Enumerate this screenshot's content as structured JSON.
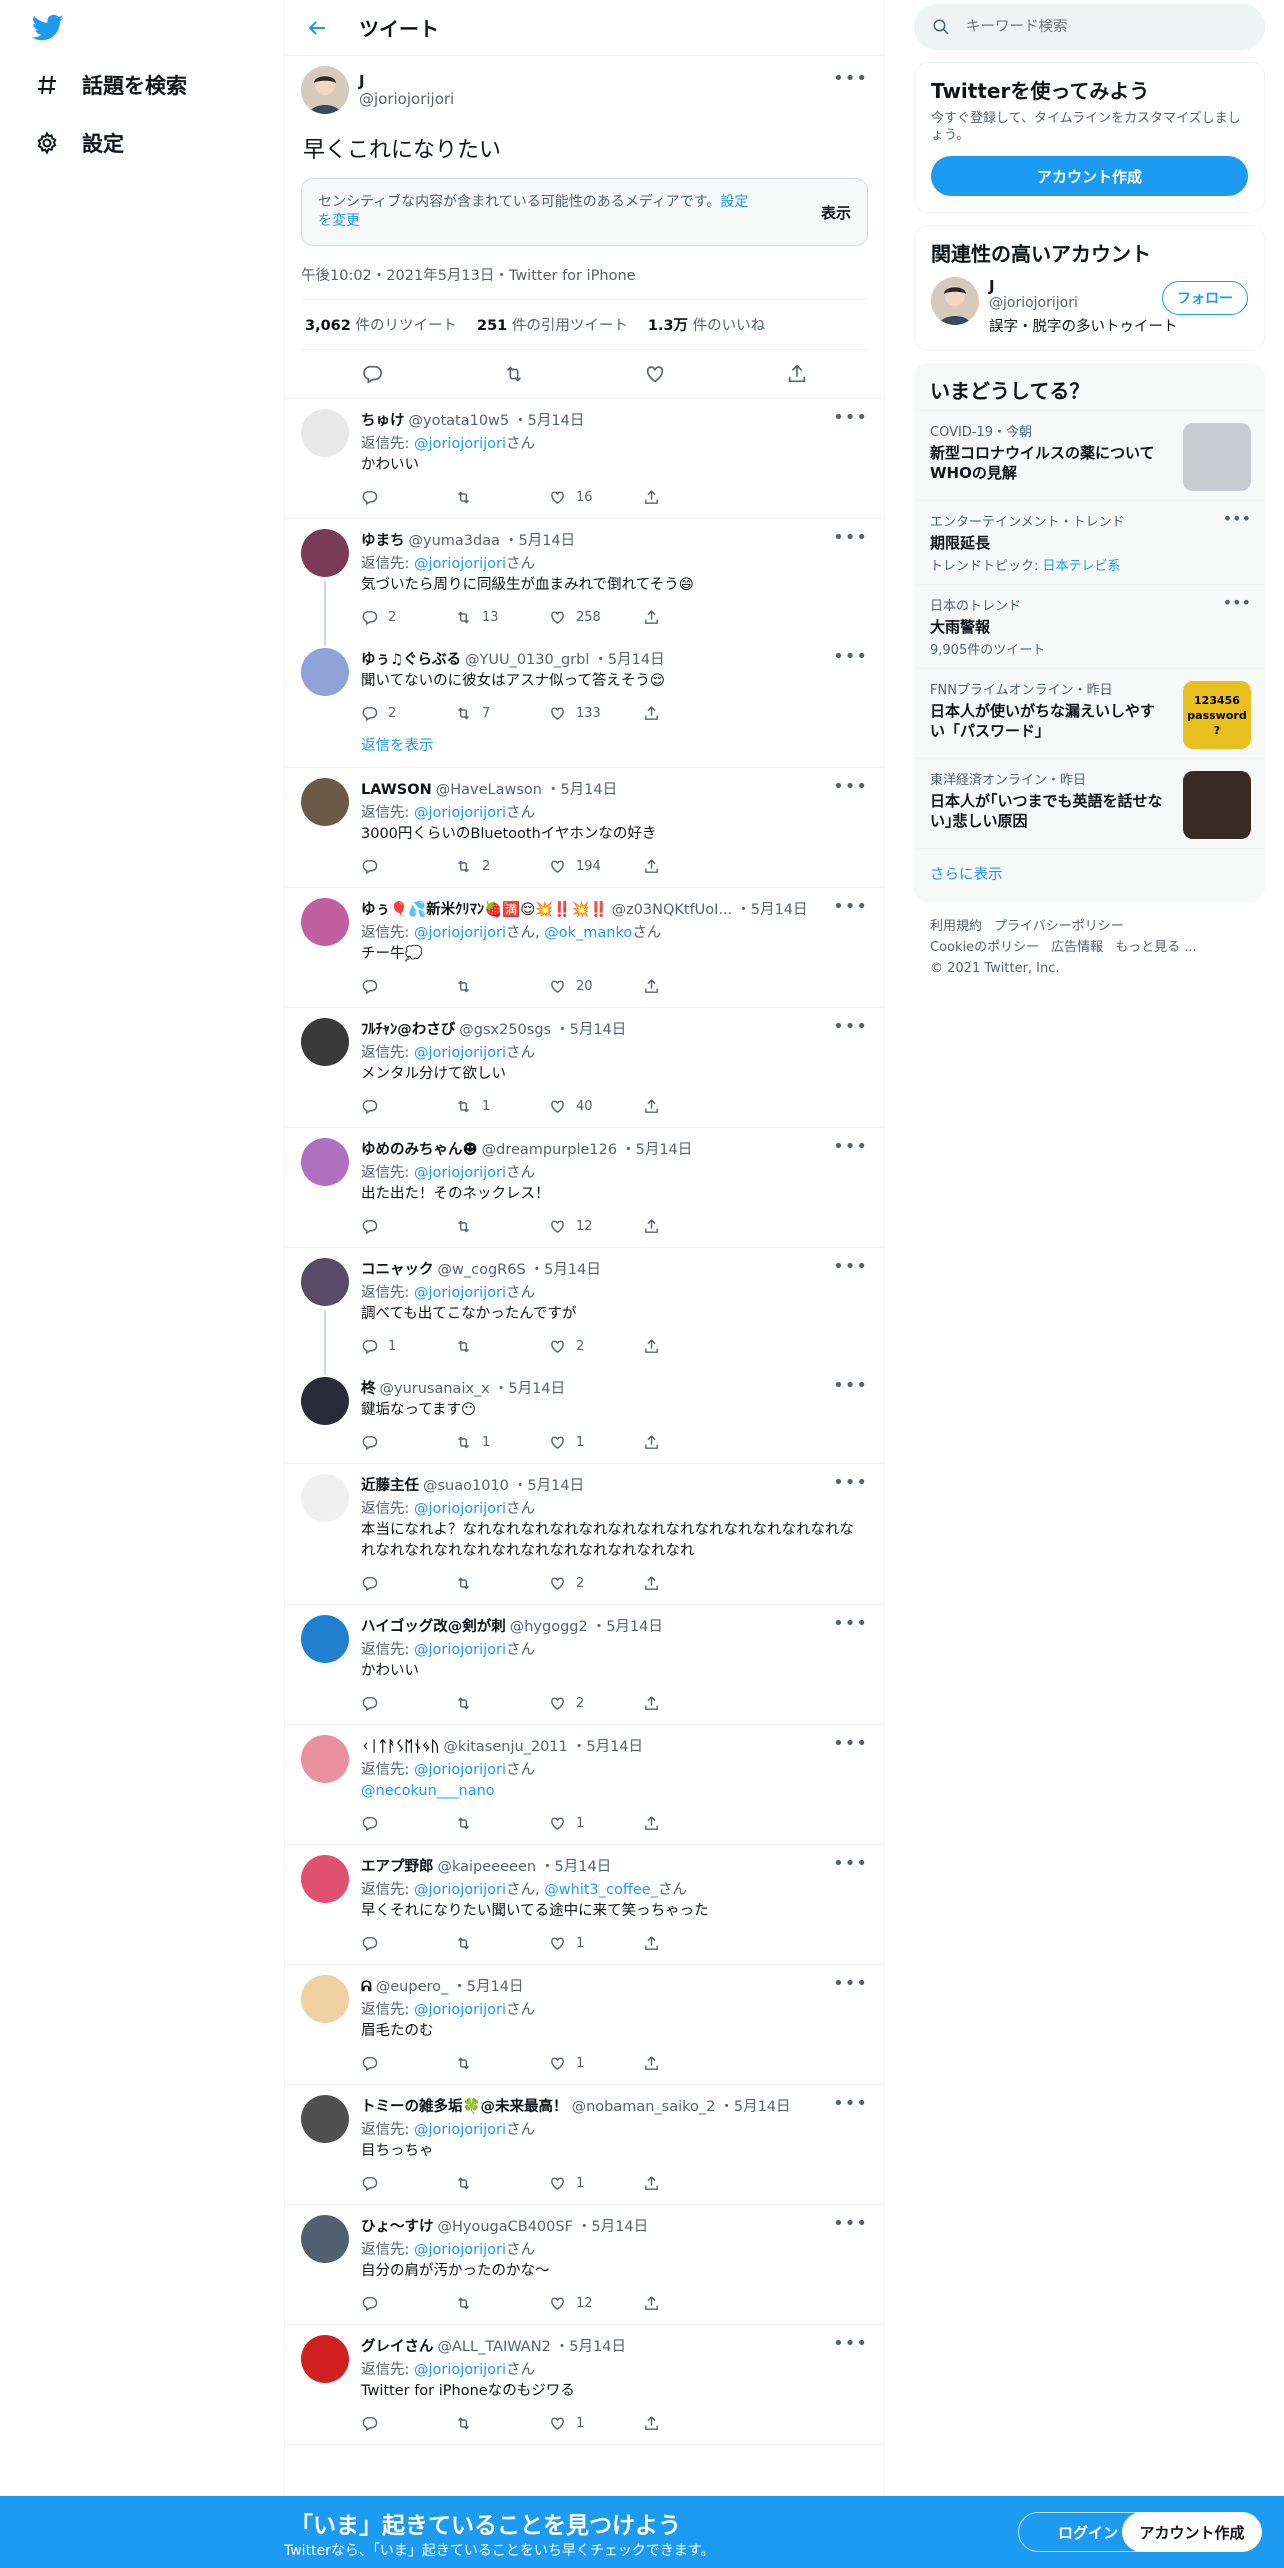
{
  "nav": {
    "explore": "話題を検索",
    "settings": "設定"
  },
  "header": {
    "title": "ツイート"
  },
  "main_tweet": {
    "name": "J",
    "handle": "@joriojorijori",
    "text": "早くこれになりたい",
    "sensitive_notice": "センシティブな内容が含まれている可能性のあるメディアです。",
    "sensitive_link1": "設定",
    "sensitive_link2": "を変更",
    "show_label": "表示",
    "meta": "午後10:02・2021年5月13日・Twitter for iPhone",
    "stats": [
      {
        "num": "3,062",
        "label": "件のリツイート"
      },
      {
        "num": "251",
        "label": "件の引用ツイート"
      },
      {
        "num": "1.3万",
        "label": "件のいいね"
      }
    ]
  },
  "replying_label": "返信先:",
  "san": "さん",
  "show_replies": "返信を表示",
  "replies": [
    {
      "name": "ちゅけ",
      "handle": "@yotata10w5",
      "date": "・5月14日",
      "to": [
        "@joriojorijori"
      ],
      "text": "かわいい",
      "replies": "",
      "rts": "",
      "likes": "16",
      "avatar": "#e8e8e8",
      "thread": "none",
      "border": true
    },
    {
      "name": "ゆまち",
      "handle": "@yuma3daa",
      "date": "・5月14日",
      "to": [
        "@joriojorijori"
      ],
      "text": "気づいたら周りに同級生が血まみれで倒れてそう😄",
      "replies": "2",
      "rts": "13",
      "likes": "258",
      "avatar": "#7a3b55",
      "thread": "start",
      "border": false
    },
    {
      "name": "ゆぅ♫ぐらぶる",
      "handle": "@YUU_0130_grbl",
      "date": "・5月14日",
      "to": [],
      "text": "聞いてないのに彼女はアスナ似って答えそう😌",
      "replies": "2",
      "rts": "7",
      "likes": "133",
      "avatar": "#8fa3d8",
      "thread": "end",
      "border": false,
      "show_replies": true
    },
    {
      "name": "LAWSON",
      "handle": "@HaveLawson",
      "date": "・5月14日",
      "to": [
        "@joriojorijori"
      ],
      "text": "3000円くらいのBluetoothイヤホンなの好き",
      "replies": "",
      "rts": "2",
      "likes": "194",
      "avatar": "#6b5a47",
      "thread": "none",
      "border": true
    },
    {
      "name": "ゆぅ🎈💦新米ｸﾘﾏﾝ🍓🈵😌💥‼️💥‼️",
      "handle": "@z03NQKtfUoI...",
      "date": "・5月14日",
      "to": [
        "@joriojorijori",
        "@ok_manko"
      ],
      "text": "チー牛💭",
      "replies": "",
      "rts": "",
      "likes": "20",
      "avatar": "#c060a0",
      "thread": "none",
      "border": true
    },
    {
      "name": "ﾌﾙﾁｬﾝ@わさび",
      "handle": "@gsx250sgs",
      "date": "・5月14日",
      "to": [
        "@joriojorijori"
      ],
      "text": "メンタル分けて欲しい",
      "replies": "",
      "rts": "1",
      "likes": "40",
      "avatar": "#3a3a3a",
      "thread": "none",
      "border": true
    },
    {
      "name": "ゆめのみちゃん☻",
      "handle": "@dreampurple126",
      "date": "・5月14日",
      "to": [
        "@joriojorijori"
      ],
      "text": "出た出た！そのネックレス！",
      "replies": "",
      "rts": "",
      "likes": "12",
      "avatar": "#b070c0",
      "thread": "none",
      "border": true
    },
    {
      "name": "コニャック",
      "handle": "@w_cogR6S",
      "date": "・5月14日",
      "to": [
        "@joriojorijori"
      ],
      "text": "調べても出てこなかったんですが",
      "replies": "1",
      "rts": "",
      "likes": "2",
      "avatar": "#5a4a6a",
      "thread": "start",
      "border": false
    },
    {
      "name": "柊",
      "handle": "@yurusanaix_x",
      "date": "・5月14日",
      "to": [],
      "text": "鍵垢なってます😶",
      "replies": "",
      "rts": "1",
      "likes": "1",
      "avatar": "#2a2a3a",
      "thread": "end",
      "border": true
    },
    {
      "name": "近藤主任",
      "handle": "@suao1010",
      "date": "・5月14日",
      "to": [
        "@joriojorijori"
      ],
      "text": "本当になれよ？なれなれなれなれなれなれなれなれなれなれなれなれなれなれなれなれなれなれなれなれなれなれなれなれなれ",
      "replies": "",
      "rts": "",
      "likes": "2",
      "avatar": "#f0f0f0",
      "thread": "none",
      "border": true
    },
    {
      "name": "ハイゴッグ改@剣が刺",
      "handle": "@hygogg2",
      "date": "・5月14日",
      "to": [
        "@joriojorijori"
      ],
      "text": "かわいい",
      "replies": "",
      "rts": "",
      "likes": "2",
      "avatar": "#2080d0",
      "thread": "none",
      "border": true
    },
    {
      "name": "ᚲᛁᛏᚨᛊᛖᚾᛃᚢ",
      "handle": "@kitasenju_2011",
      "date": "・5月14日",
      "to": [
        "@joriojorijori"
      ],
      "text": "@necokun___nano",
      "text_is_mention": true,
      "replies": "",
      "rts": "",
      "likes": "1",
      "avatar": "#e890a0",
      "thread": "none",
      "border": true
    },
    {
      "name": "エアプ野郎",
      "handle": "@kaipeeeeen",
      "date": "・5月14日",
      "to": [
        "@joriojorijori",
        "@whit3_coffee_"
      ],
      "text": "早くそれになりたい聞いてる途中に来て笑っちゃった",
      "replies": "",
      "rts": "",
      "likes": "1",
      "avatar": "#e05070",
      "thread": "none",
      "border": true
    },
    {
      "name": "ᕱ",
      "handle": "@eupero_",
      "date": "・5月14日",
      "to": [
        "@joriojorijori"
      ],
      "text": "眉毛たのむ",
      "replies": "",
      "rts": "",
      "likes": "1",
      "avatar": "#f0d0a0",
      "thread": "none",
      "border": true
    },
    {
      "name": "トミーの雑多垢🍀@未来最高！",
      "handle": "@nobaman_saiko_2",
      "date": "・5月14日",
      "to": [
        "@joriojorijori"
      ],
      "text": "目ちっちゃ",
      "replies": "",
      "rts": "",
      "likes": "1",
      "avatar": "#505050",
      "thread": "none",
      "border": true
    },
    {
      "name": "ひょ〜すけ",
      "handle": "@HyougaCB400SF",
      "date": "・5月14日",
      "to": [
        "@joriojorijori"
      ],
      "text": "自分の肩が汚かったのかな〜",
      "replies": "",
      "rts": "",
      "likes": "12",
      "avatar": "#506070",
      "thread": "none",
      "border": true
    },
    {
      "name": "グレイさん",
      "handle": "@ALL_TAIWAN2",
      "date": "・5月14日",
      "to": [
        "@joriojorijori"
      ],
      "text": "Twitter for iPhoneなのもジワる",
      "replies": "",
      "rts": "",
      "likes": "1",
      "avatar": "#d02020",
      "thread": "none",
      "border": true
    }
  ],
  "sidebar": {
    "search_placeholder": "キーワード検索",
    "join_title": "Twitterを使ってみよう",
    "join_text": "今すぐ登録して、タイムラインをカスタマイズしましょう。",
    "create_account": "アカウント作成",
    "related_title": "関連性の高いアカウント",
    "related": {
      "name": "J",
      "handle": "@joriojorijori",
      "bio": "誤字・脱字の多いトゥイート",
      "follow": "フォロー"
    },
    "trends_title": "いまどうしてる？",
    "trends": [
      {
        "cat": "COVID-19・今朝",
        "title": "新型コロナウイルスの薬についてWHOの見解",
        "thumb": "#c8ccd0",
        "dots": false
      },
      {
        "cat": "エンターテインメント・トレンド",
        "title": "期限延長",
        "sub_prefix": "トレンドトピック: ",
        "sub_link": "日本テレビ系",
        "dots": true
      },
      {
        "cat": "日本のトレンド",
        "title": "大雨警報",
        "sub": "9,905件のツイート",
        "dots": true
      },
      {
        "cat": "FNNプライムオンライン",
        "cat_suffix": "・昨日",
        "title": "日本人が使いがちな漏えいしやすい「パスワード」",
        "thumb": "#e8c020",
        "thumb_text": "123456 password ?",
        "dots": false
      },
      {
        "cat": "東洋経済オンライン",
        "cat_suffix": "・昨日",
        "title": "日本人が｢いつまでも英語を話せない｣悲しい原因",
        "thumb": "#3a2a24",
        "dots": false
      }
    ],
    "show_more": "さらに表示",
    "footer": [
      "利用規約",
      "プライバシーポリシー",
      "Cookieのポリシー",
      "広告情報",
      "もっと見る ..."
    ],
    "copyright": "© 2021 Twitter, Inc."
  },
  "bottom_bar": {
    "headline": "「いま」起きていることを見つけよう",
    "sub": "Twitterなら、「いま」起きていることをいち早くチェックできます。",
    "login": "ログイン",
    "signup": "アカウント作成"
  },
  "colors": {
    "accent": "#1d9bf0",
    "text": "#0f1419",
    "muted": "#536471",
    "border": "#eff3f4"
  }
}
